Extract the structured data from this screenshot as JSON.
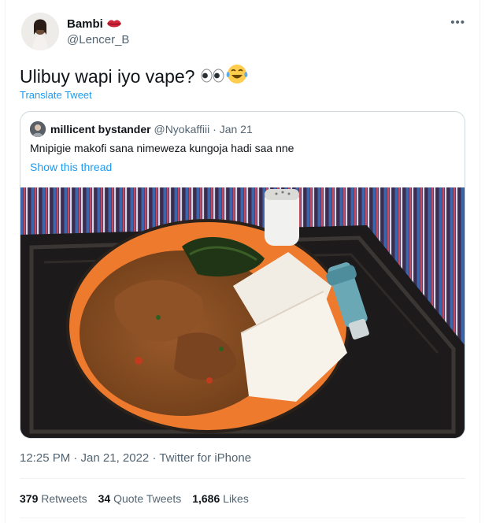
{
  "author": {
    "name": "Bambi",
    "handle": "@Lencer_B",
    "badge_icon": "lips-emoji-icon",
    "more_label": "•••"
  },
  "tweet": {
    "text": "Ulibuy wapi iyo vape?",
    "emojis": [
      "eyes-emoji-icon",
      "joy-emoji-icon"
    ],
    "translate_label": "Translate Tweet"
  },
  "quote": {
    "author_name": "millicent bystander",
    "author_handle": "@Nyokaffiii",
    "date": "Jan 21",
    "separator": "·",
    "text": "Mnipigie makofi sana nimeweza kungoja hadi saa nne",
    "show_thread": "Show this thread",
    "image": "photo of ugali, stew and greens on a plate with an inhaler"
  },
  "meta": {
    "timestamp": "12:25 PM · Jan 21, 2022 · Twitter for iPhone"
  },
  "stats": {
    "retweets": {
      "count": "379",
      "label": "Retweets"
    },
    "quotes": {
      "count": "34",
      "label": "Quote Tweets"
    },
    "likes": {
      "count": "1,686",
      "label": "Likes"
    }
  },
  "colors": {
    "accent": "#1d9bf0",
    "secondary_text": "#536471",
    "border": "#cfd9de"
  }
}
